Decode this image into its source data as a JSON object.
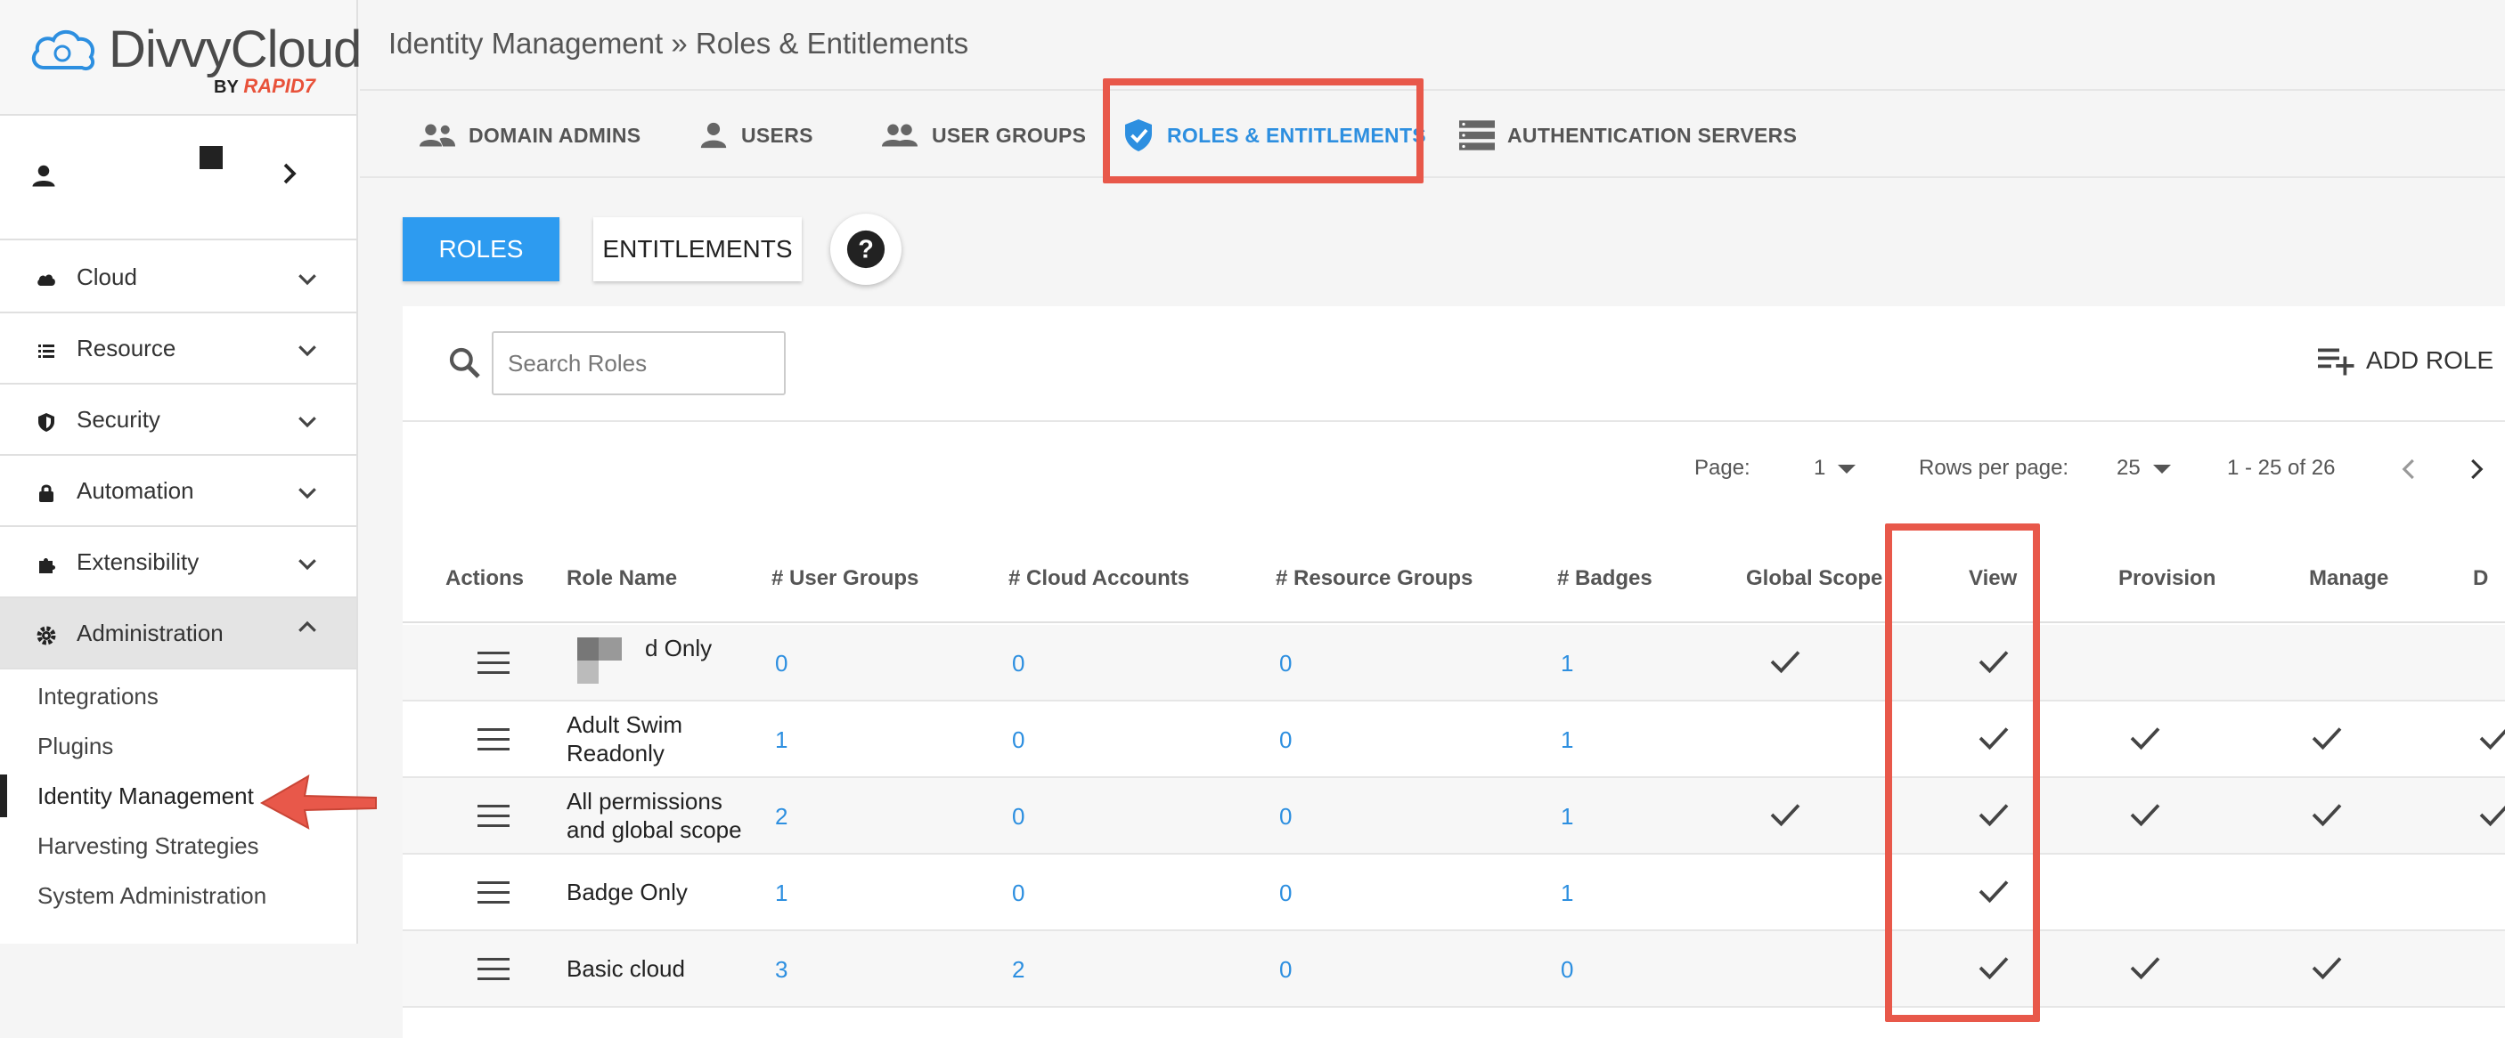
{
  "app": {
    "logo_text": "DivvyCloud",
    "logo_by": "BY",
    "logo_brand": "RAPID7"
  },
  "sidebar": {
    "items": [
      {
        "label": "Cloud",
        "icon": "cloud-icon"
      },
      {
        "label": "Resource",
        "icon": "list-icon"
      },
      {
        "label": "Security",
        "icon": "shield-icon"
      },
      {
        "label": "Automation",
        "icon": "lock-icon"
      },
      {
        "label": "Extensibility",
        "icon": "puzzle-icon"
      },
      {
        "label": "Administration",
        "icon": "gear-icon"
      }
    ],
    "sub_items": [
      {
        "label": "Integrations"
      },
      {
        "label": "Plugins"
      },
      {
        "label": "Identity Management"
      },
      {
        "label": "Harvesting Strategies"
      },
      {
        "label": "System Administration"
      }
    ]
  },
  "header": {
    "breadcrumb": "Identity Management » Roles & Entitlements"
  },
  "tabs": [
    {
      "label": "DOMAIN ADMINS",
      "icon": "people-icon"
    },
    {
      "label": "USERS",
      "icon": "person-icon"
    },
    {
      "label": "USER GROUPS",
      "icon": "group-icon"
    },
    {
      "label": "ROLES & ENTITLEMENTS",
      "icon": "verified-shield-icon"
    },
    {
      "label": "AUTHENTICATION SERVERS",
      "icon": "server-icon"
    }
  ],
  "toolbar": {
    "roles_label": "ROLES",
    "entitlements_label": "ENTITLEMENTS",
    "help_label": "?",
    "add_role_label": "ADD ROLE"
  },
  "search": {
    "placeholder": "Search Roles",
    "value": ""
  },
  "pagination": {
    "page_label": "Page:",
    "page_value": "1",
    "rows_label": "Rows per page:",
    "rows_value": "25",
    "range": "1 - 25 of 26"
  },
  "table": {
    "columns": [
      "Actions",
      "Role Name",
      "# User Groups",
      "# Cloud Accounts",
      "# Resource Groups",
      "# Badges",
      "Global Scope",
      "View",
      "Provision",
      "Manage",
      "D"
    ],
    "rows": [
      {
        "name_line1": "d Only",
        "name_line2": "",
        "user_groups": "0",
        "cloud_accounts": "0",
        "resource_groups": "0",
        "badges": "1",
        "global_scope": true,
        "view": true,
        "provision": false,
        "manage": false,
        "d": false
      },
      {
        "name_line1": "Adult Swim",
        "name_line2": "Readonly",
        "user_groups": "1",
        "cloud_accounts": "0",
        "resource_groups": "0",
        "badges": "1",
        "global_scope": false,
        "view": true,
        "provision": true,
        "manage": true,
        "d": true
      },
      {
        "name_line1": "All permissions",
        "name_line2": "and global scope",
        "user_groups": "2",
        "cloud_accounts": "0",
        "resource_groups": "0",
        "badges": "1",
        "global_scope": true,
        "view": true,
        "provision": true,
        "manage": true,
        "d": true
      },
      {
        "name_line1": "Badge Only",
        "name_line2": "",
        "user_groups": "1",
        "cloud_accounts": "0",
        "resource_groups": "0",
        "badges": "1",
        "global_scope": false,
        "view": true,
        "provision": false,
        "manage": false,
        "d": false
      },
      {
        "name_line1": "Basic cloud",
        "name_line2": "",
        "user_groups": "3",
        "cloud_accounts": "2",
        "resource_groups": "0",
        "badges": "0",
        "global_scope": false,
        "view": true,
        "provision": true,
        "manage": true,
        "d": false
      }
    ]
  },
  "colors": {
    "accent": "#2d8fe0",
    "primary_button": "#2d9bf0",
    "annotation": "#e8584a"
  }
}
